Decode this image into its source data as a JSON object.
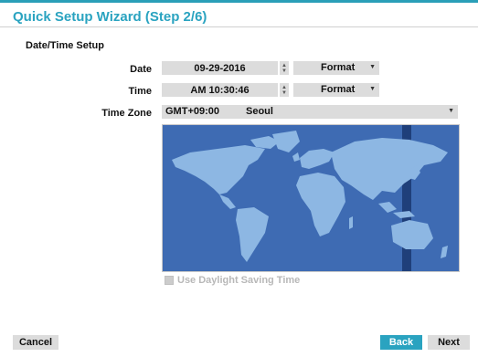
{
  "header": {
    "title": "Quick Setup Wizard (Step 2/6)"
  },
  "section": {
    "title": "Date/Time Setup"
  },
  "date": {
    "label": "Date",
    "value": "09-29-2016",
    "format_label": "Format"
  },
  "time": {
    "label": "Time",
    "value": "AM 10:30:46",
    "format_label": "Format"
  },
  "timezone": {
    "label": "Time Zone",
    "offset": "GMT+09:00",
    "city": "Seoul"
  },
  "dst": {
    "label": "Use Daylight Saving Time",
    "checked": false,
    "enabled": false
  },
  "buttons": {
    "cancel": "Cancel",
    "back": "Back",
    "next": "Next"
  },
  "colors": {
    "accent": "#2aa3c0",
    "map_ocean": "#3e6bb3",
    "map_land": "#8db7e3",
    "zone_band": "#1f3f7a"
  }
}
